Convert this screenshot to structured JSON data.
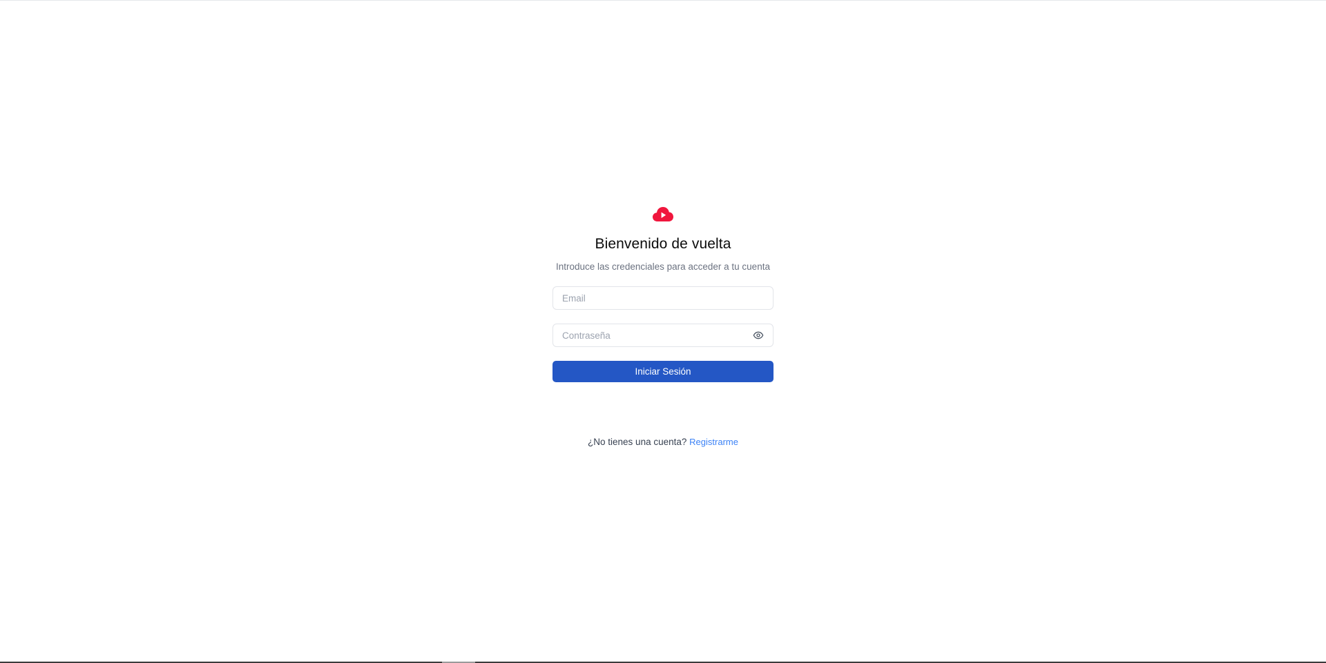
{
  "brand": {
    "logo_icon": "cloud-play-icon",
    "logo_color": "#f0163d"
  },
  "login": {
    "title": "Bienvenido de vuelta",
    "subtitle": "Introduce las credenciales para acceder a tu cuenta",
    "email": {
      "value": "",
      "placeholder": "Email"
    },
    "password": {
      "value": "",
      "placeholder": "Contraseña",
      "toggle_icon": "eye-icon"
    },
    "submit_label": "Iniciar Sesión",
    "accent_color": "#2457c5"
  },
  "signup": {
    "prompt": "¿No tienes una cuenta?",
    "link_label": "Registrarme",
    "link_color": "#3b82f6"
  }
}
